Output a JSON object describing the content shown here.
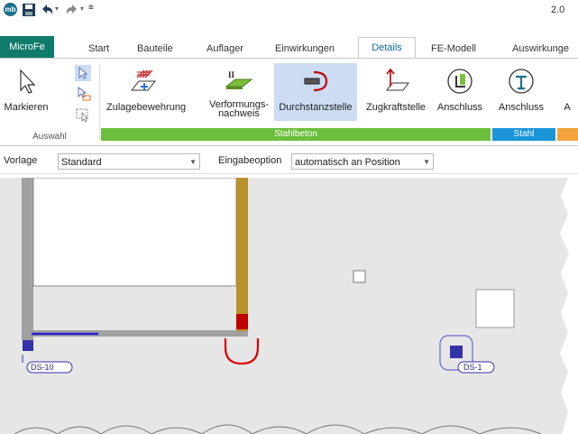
{
  "window": {
    "title_partial": "2.0"
  },
  "quick_access": {
    "icons": [
      "app-logo-icon",
      "save-icon",
      "undo-icon",
      "redo-icon",
      "customize-icon"
    ]
  },
  "tabs": [
    {
      "label": "MicroFe",
      "active": false,
      "app": true
    },
    {
      "label": "Start"
    },
    {
      "label": "Bauteile"
    },
    {
      "label": "Auflager"
    },
    {
      "label": "Einwirkungen"
    },
    {
      "label": "Details",
      "active": true
    },
    {
      "label": "FE-Modell"
    },
    {
      "label": "Auswirkunge"
    }
  ],
  "ribbon": {
    "buttons": [
      {
        "label": "Markieren",
        "icon": "cursor-icon"
      },
      {
        "label": "Zulagebewehrung",
        "icon": "reinforcement-icon"
      },
      {
        "label": "Verformungs-",
        "label2": "nachweis",
        "icon": "deformation-icon"
      },
      {
        "label": "Durchstanzstelle",
        "icon": "punching-icon",
        "selected": true
      },
      {
        "label": "Zugkraftstelle",
        "icon": "tension-icon"
      },
      {
        "label": "Anschluss",
        "icon": "connection-icon"
      },
      {
        "label": "Anschluss",
        "icon": "steel-connection-icon"
      },
      {
        "label": "A",
        "icon": "more-icon"
      }
    ],
    "groups": [
      {
        "label": "Auswahl",
        "color": "#ffffff"
      },
      {
        "label": "Stahlbeton",
        "color": "#6cbf3c"
      },
      {
        "label": "Stahl",
        "color": "#1b95d8"
      },
      {
        "label": "",
        "color": "#f2a33a"
      }
    ]
  },
  "options": {
    "vorlage_label": "Vorlage",
    "vorlage_value": "Standard",
    "eingabe_label": "Eingabeoption",
    "eingabe_value": "automatisch an Position"
  },
  "canvas": {
    "markers": [
      {
        "label": "DS-10"
      },
      {
        "label": "DS-1"
      }
    ]
  },
  "colors": {
    "app_tab": "#0f7c6b",
    "active_tab_text": "#0f6aa6",
    "selected_button": "#cbdcf3",
    "canvas_bg": "#e6e6e6",
    "punching_marker": "#3333aa",
    "column": "#b8912b",
    "column_base": "#c00000",
    "wall": "#a0a0a0"
  }
}
